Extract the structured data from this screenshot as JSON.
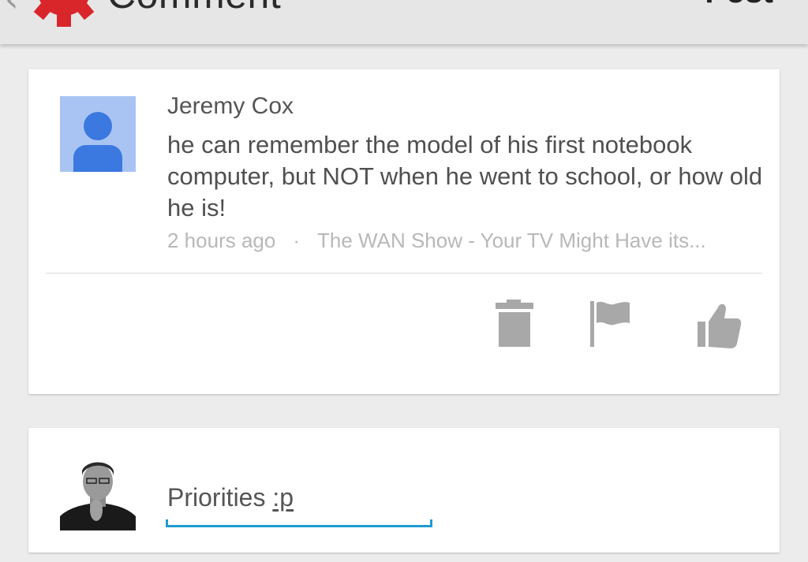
{
  "app_bar": {
    "title": "Comment",
    "post_label": "Post",
    "back_icon": "chevron-left-icon",
    "logo_icon": "gear-logo-icon"
  },
  "comment": {
    "author": "Jeremy Cox",
    "text": "he can remember the model of his first notebook computer, but NOT when he went to school, or how old he is!",
    "time": "2 hours ago",
    "separator": "·",
    "video_title": "The WAN Show - Your TV Might Have its...",
    "actions": [
      {
        "name": "delete",
        "icon": "trash-icon"
      },
      {
        "name": "flag",
        "icon": "flag-icon"
      },
      {
        "name": "like",
        "icon": "thumbs-up-icon"
      }
    ]
  },
  "reply": {
    "value_plain": "Priorities ",
    "value_underlined": ":p"
  },
  "colors": {
    "background": "#ececec",
    "card": "#ffffff",
    "icon_gray": "#a8a8a8",
    "avatar_bg": "#a9c4f3",
    "avatar_fg": "#3b78e0",
    "accent_underline": "#1e9bd0",
    "logo_red": "#d9262b",
    "meta_text": "#b8b8b8"
  }
}
